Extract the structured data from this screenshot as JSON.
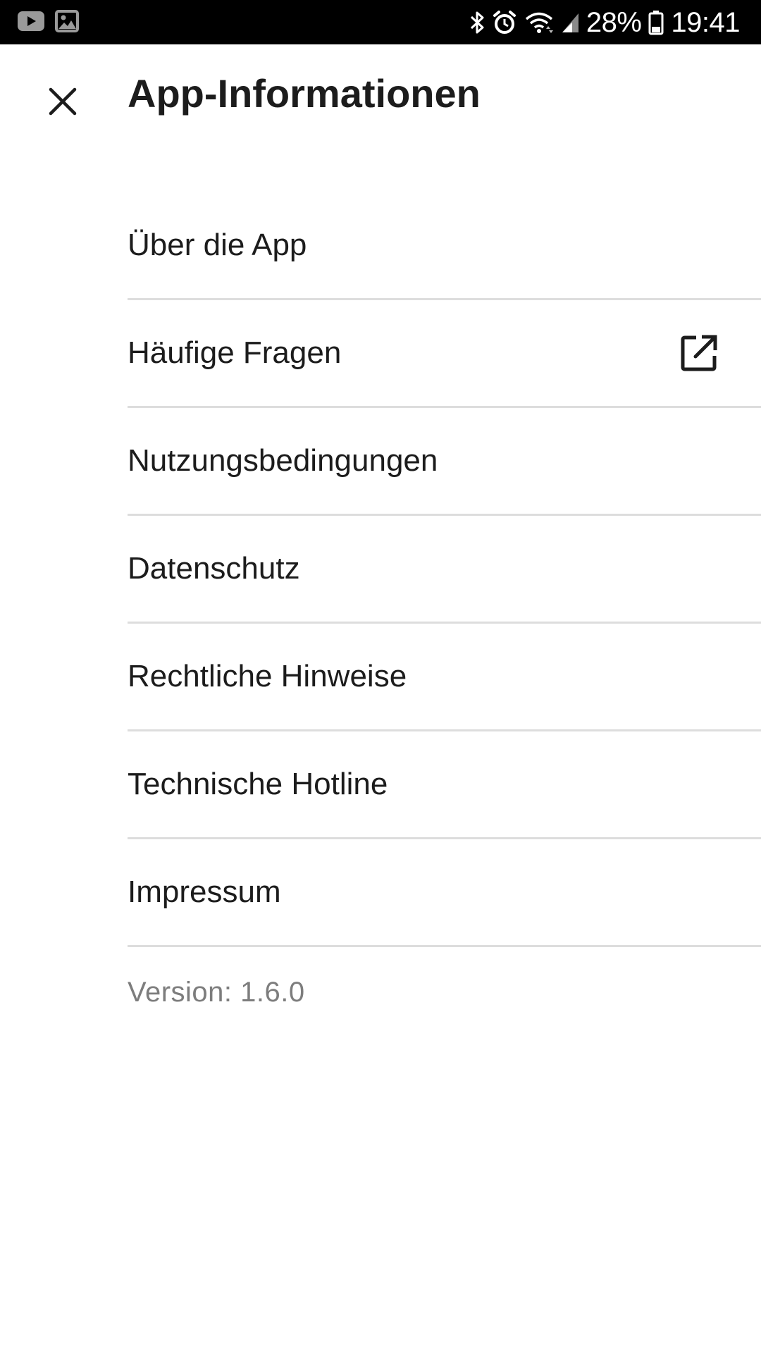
{
  "status_bar": {
    "battery_percent": "28%",
    "time": "19:41",
    "left_icons": [
      "youtube-icon",
      "image-icon"
    ],
    "right_icons": [
      "bluetooth-icon",
      "alarm-icon",
      "wifi-icon",
      "signal-icon",
      "battery-icon"
    ]
  },
  "app_bar": {
    "title": "App-Informationen",
    "close_icon": "close-icon"
  },
  "menu": {
    "items": [
      {
        "label": "Über die App"
      },
      {
        "label": "Häufige Fragen",
        "icon": "external-link-icon"
      },
      {
        "label": "Nutzungsbedingungen"
      },
      {
        "label": "Datenschutz"
      },
      {
        "label": "Rechtliche Hinweise"
      },
      {
        "label": "Technische Hotline"
      },
      {
        "label": "Impressum"
      }
    ]
  },
  "version": "Version: 1.6.0",
  "colors": {
    "status_bar_bg": "#000000",
    "background": "#ffffff",
    "text_primary": "#1c1c1c",
    "text_secondary": "#7d7d7d",
    "divider": "#dddddd"
  }
}
